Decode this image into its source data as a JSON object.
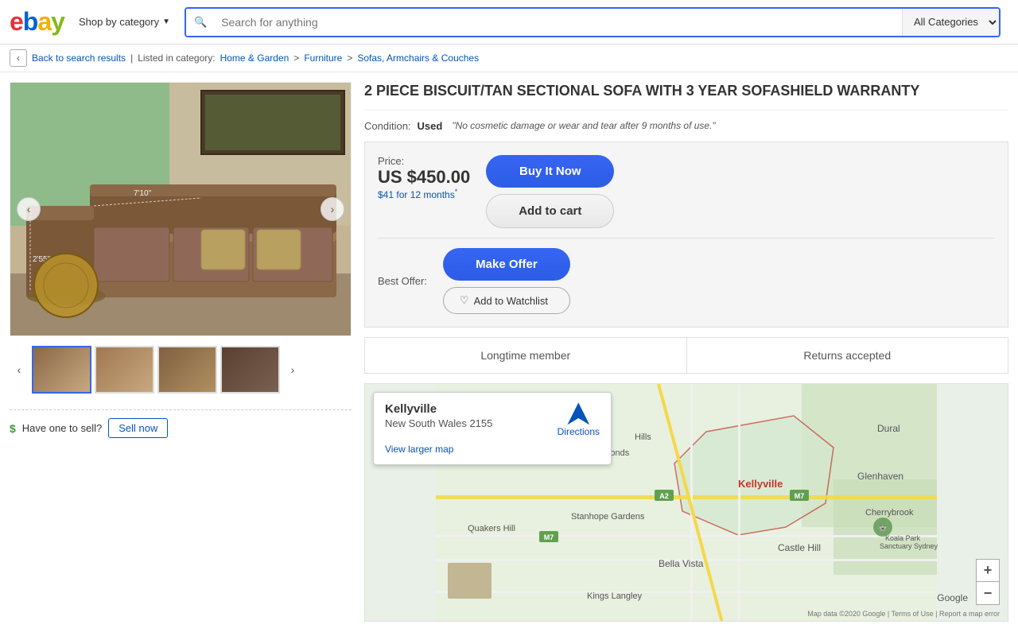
{
  "header": {
    "logo_letters": [
      "e",
      "b",
      "a",
      "y"
    ],
    "shop_by_category": "Shop by category",
    "search_placeholder": "Search for anything",
    "category_select": "All Categories"
  },
  "breadcrumb": {
    "back_text": "Back to search results",
    "listed_in": "Listed in category:",
    "category1": "Home & Garden",
    "category2": "Furniture",
    "category3": "Sofas, Armchairs & Couches"
  },
  "product": {
    "title": "2 PIECE BISCUIT/TAN SECTIONAL SOFA WITH 3 YEAR SOFASHIELD WARRANTY",
    "condition_label": "Condition:",
    "condition_value": "Used",
    "condition_note": "\"No cosmetic damage or wear and tear after 9 months of use.\"",
    "price_label": "Price:",
    "price": "US $450.00",
    "installment": "$41 for 12 months",
    "installment_sup": "*",
    "best_offer_label": "Best Offer:",
    "btn_buy_now": "Buy It Now",
    "btn_add_cart": "Add to cart",
    "btn_make_offer": "Make Offer",
    "btn_watchlist": "Add to Watchlist",
    "seller_longtime": "Longtime member",
    "seller_returns": "Returns accepted"
  },
  "sell_section": {
    "text": "Have one to sell?",
    "btn": "Sell now"
  },
  "map": {
    "location": "Kellyville",
    "state": "New South Wales 2155",
    "directions_label": "Directions",
    "view_larger": "View larger map",
    "label_dural": "Dural",
    "label_glenhaven": "Glenhaven",
    "label_ponds": "The Ponds",
    "label_hills": "Hills",
    "label_quakers": "Quakers Hill",
    "label_stanhope": "Stanhope Gardens",
    "label_castle_hill": "Castle Hill",
    "label_bella_vista": "Bella Vista",
    "label_kings_langley": "Kings Langley",
    "label_cherrybrook": "Cherrybrook",
    "label_kellyville_map": "Kellyville",
    "label_koala": "Koala Park Sanctuary Sydney",
    "zoom_in": "+",
    "zoom_out": "−",
    "google_logo": "Google",
    "map_credit": "Map data ©2020 Google | Terms of Use | Report a map error"
  }
}
